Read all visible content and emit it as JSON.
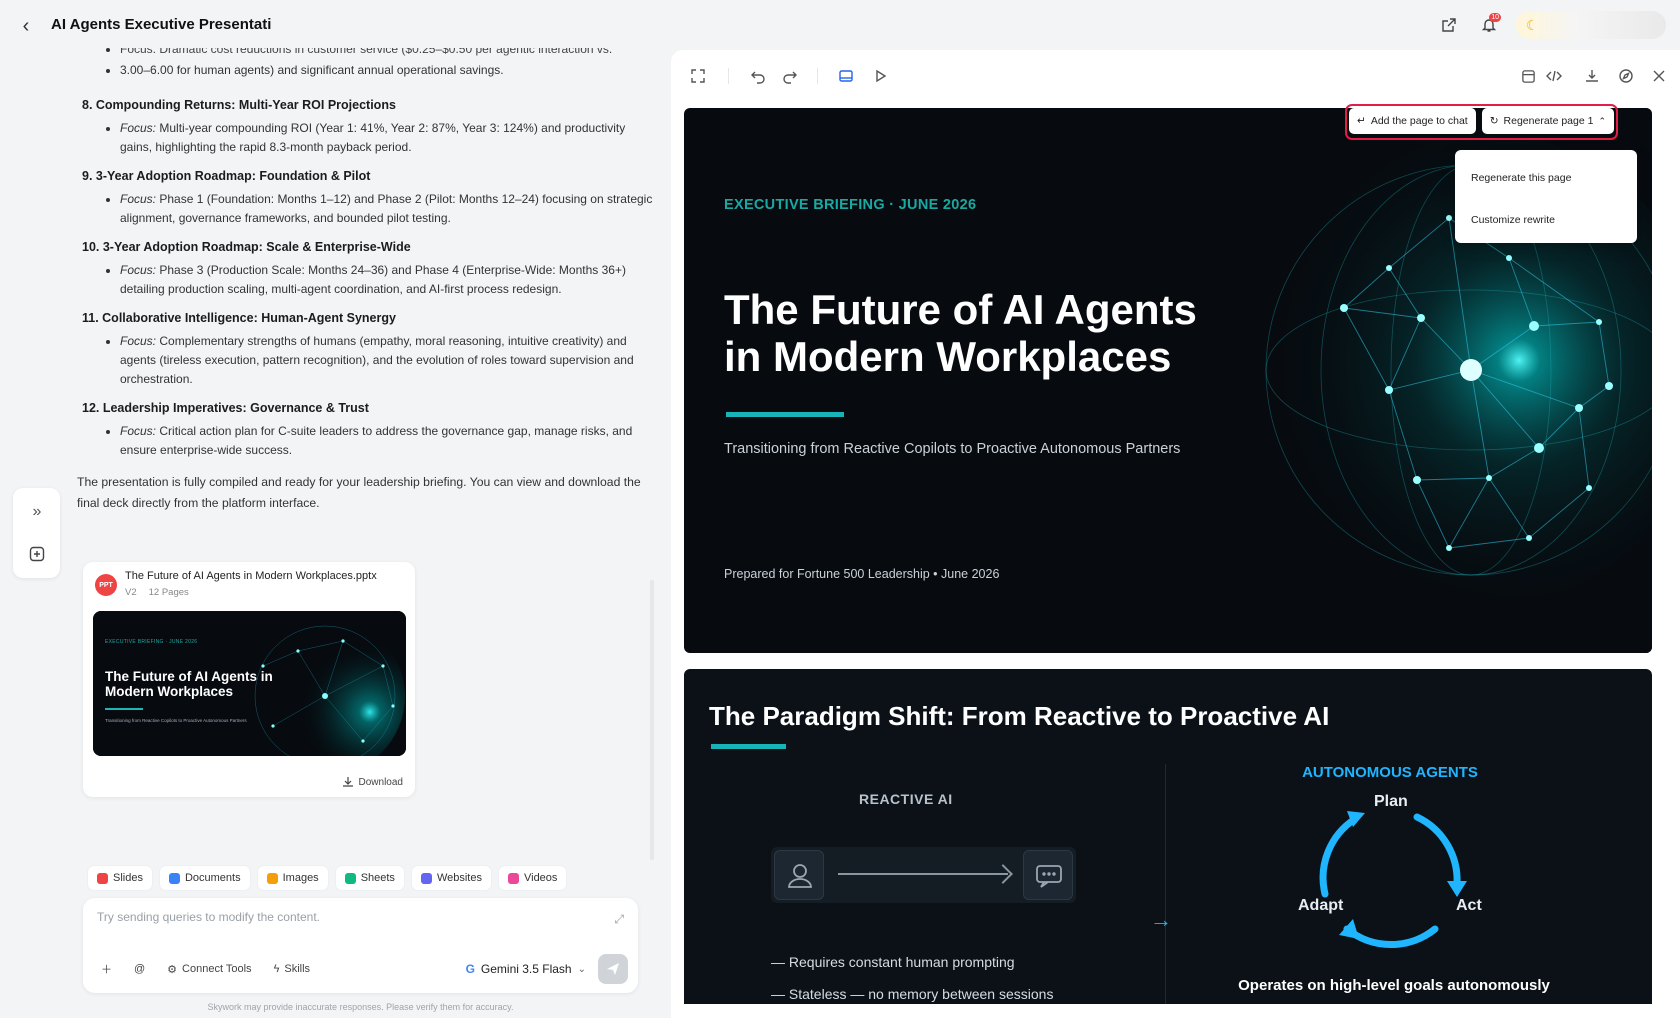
{
  "header": {
    "title": "AI Agents Executive Presentati",
    "notification_count": "10"
  },
  "chat": {
    "intro_tail_1": "Focus: Dramatic cost reductions in customer service ($0.25–$0.50 per agentic interaction vs.",
    "intro_tail_2": "3.00–6.00 for human agents) and significant annual operational savings.",
    "sections": [
      {
        "heading": "8. Compounding Returns: Multi-Year ROI Projections",
        "focus": "Focus:",
        "text": "Multi-year compounding ROI (Year 1: 41%, Year 2: 87%, Year 3: 124%) and productivity gains, highlighting the rapid 8.3-month payback period."
      },
      {
        "heading": "9. 3-Year Adoption Roadmap: Foundation & Pilot",
        "focus": "Focus:",
        "text": "Phase 1 (Foundation: Months 1–12) and Phase 2 (Pilot: Months 12–24) focusing on strategic alignment, governance frameworks, and bounded pilot testing."
      },
      {
        "heading": "10. 3-Year Adoption Roadmap: Scale & Enterprise-Wide",
        "focus": "Focus:",
        "text": "Phase 3 (Production Scale: Months 24–36) and Phase 4 (Enterprise-Wide: Months 36+) detailing production scaling, multi-agent coordination, and AI-first process redesign."
      },
      {
        "heading": "11. Collaborative Intelligence: Human-Agent Synergy",
        "focus": "Focus:",
        "text": "Complementary strengths of humans (empathy, moral reasoning, intuitive creativity) and agents (tireless execution, pattern recognition), and the evolution of roles toward supervision and orchestration."
      },
      {
        "heading": "12. Leadership Imperatives: Governance & Trust",
        "focus": "Focus:",
        "text": "Critical action plan for C-suite leaders to address the governance gap, manage risks, and ensure enterprise-wide success."
      }
    ],
    "closing": "The presentation is fully compiled and ready for your leadership briefing. You can view and download the final deck directly from the platform interface.",
    "file_card": {
      "icon": "PPT",
      "name": "The Future of AI Agents in Modern Workplaces.pptx",
      "version": "V2",
      "pages": "12 Pages",
      "thumb_kicker": "EXECUTIVE BRIEFING · JUNE 2026",
      "thumb_title": "The Future of AI Agents in Modern Workplaces",
      "thumb_sub": "Transitioning from Reactive Copilots to Proactive Autonomous Partners",
      "download": "Download"
    },
    "tags": [
      {
        "label": "Slides",
        "color": "#ef4444"
      },
      {
        "label": "Documents",
        "color": "#3b82f6"
      },
      {
        "label": "Images",
        "color": "#f59e0b"
      },
      {
        "label": "Sheets",
        "color": "#10b981"
      },
      {
        "label": "Websites",
        "color": "#6366f1"
      },
      {
        "label": "Videos",
        "color": "#ec4899"
      }
    ],
    "composer": {
      "placeholder": "Try sending queries to modify the content.",
      "connect_tools": "Connect Tools",
      "skills": "Skills",
      "model": "Gemini 3.5 Flash"
    },
    "disclaimer": "Skywork may provide inaccurate responses. Please verify them for accuracy."
  },
  "viewer": {
    "slide_actions": {
      "add_to_chat": "Add the page to chat",
      "regenerate": "Regenerate page 1"
    },
    "dropdown": [
      "Regenerate this page",
      "Customize rewrite"
    ],
    "slide1": {
      "kicker": "EXECUTIVE BRIEFING · JUNE 2026",
      "title": "The Future of AI Agents in Modern Workplaces",
      "subtitle": "Transitioning from Reactive Copilots to Proactive Autonomous Partners",
      "footer": "Prepared for Fortune 500 Leadership • June 2026"
    },
    "slide2": {
      "title": "The Paradigm Shift: From Reactive to Proactive AI",
      "reactive_label": "REACTIVE AI",
      "autonomous_label": "AUTONOMOUS AGENTS",
      "cycle": {
        "plan": "Plan",
        "act": "Act",
        "adapt": "Adapt"
      },
      "req1": "— Requires constant human prompting",
      "req2": "— Stateless — no memory between sessions",
      "goal": "Operates on high-level goals autonomously"
    },
    "accent": "#17b3b9"
  }
}
